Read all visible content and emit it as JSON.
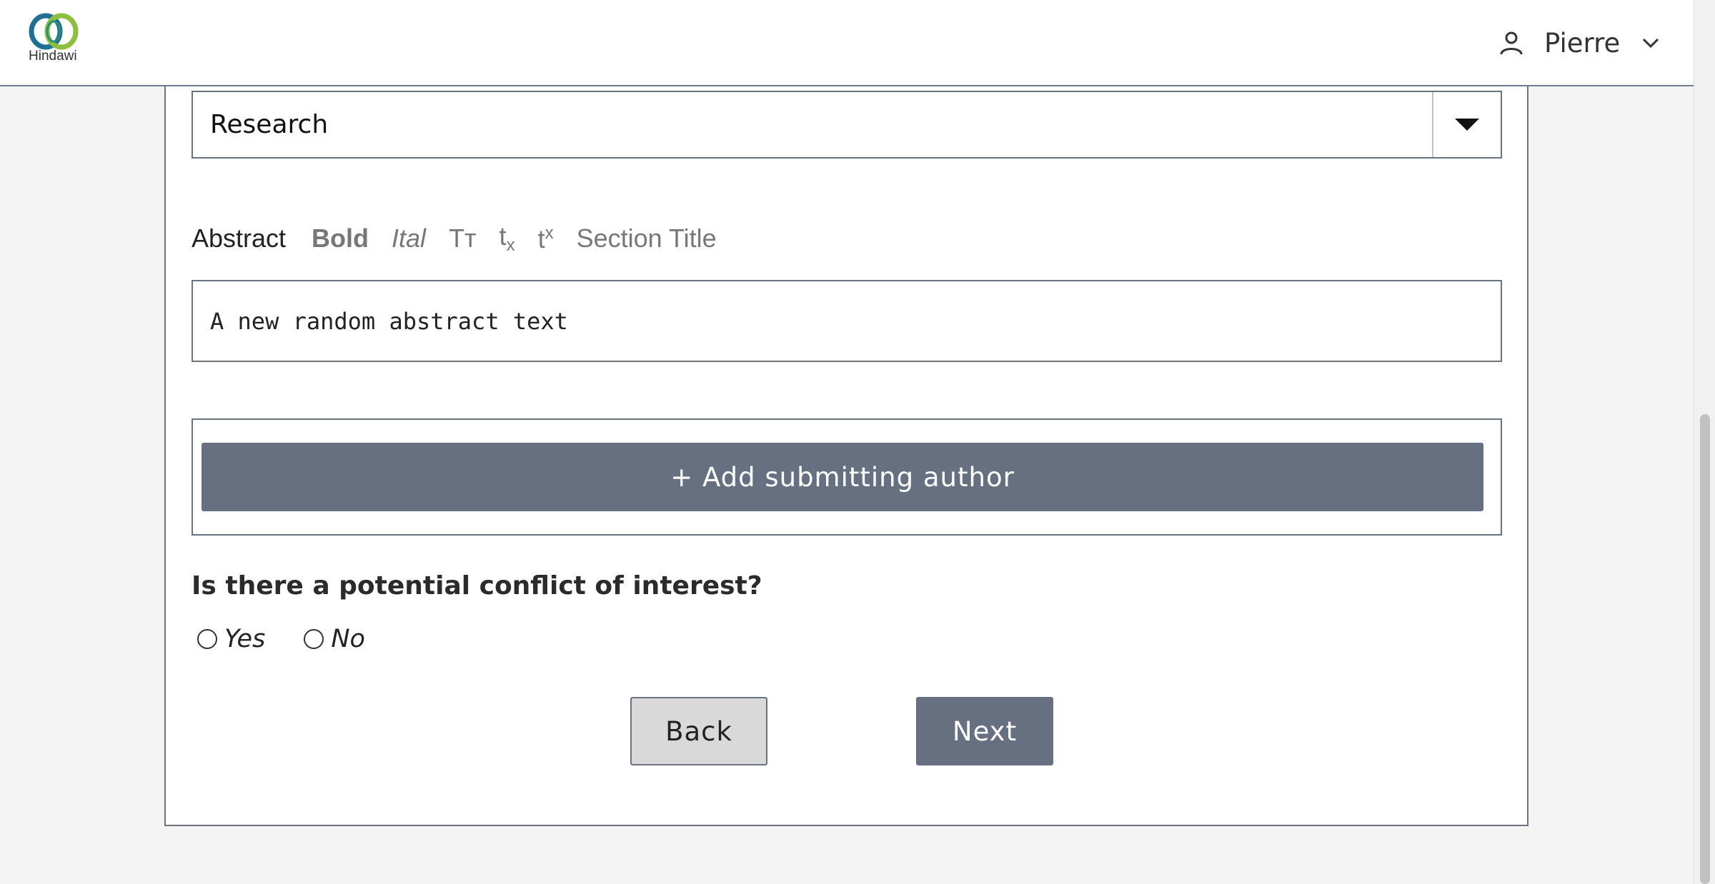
{
  "header": {
    "logo_text": "Hindawi",
    "user_name": "Pierre"
  },
  "form": {
    "article_type_value": "Research",
    "abstract_label": "Abstract",
    "toolbar": {
      "bold": "Bold",
      "italic": "Ital",
      "small_caps": "Tт",
      "subscript_base": "t",
      "subscript_mark": "x",
      "superscript_base": "t",
      "superscript_mark": "x",
      "section_title": "Section Title"
    },
    "abstract_value": "A new random abstract text",
    "add_author_label": "+ Add submitting author",
    "conflict_question": "Is there a potential conflict of interest?",
    "radio_yes": "Yes",
    "radio_no": "No",
    "back_label": "Back",
    "next_label": "Next"
  },
  "colors": {
    "primary_button": "#667080",
    "border": "#6b7280",
    "background": "#f4f4f4"
  }
}
